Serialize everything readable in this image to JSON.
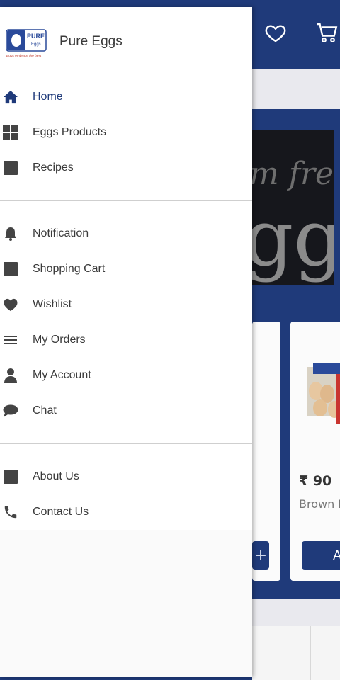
{
  "app": {
    "brand_name": "Pure Eggs",
    "logo_text_top": "PURE",
    "logo_text_sub": "Eggs",
    "logo_tagline": "Eggs embrace the best"
  },
  "drawer": {
    "section1": [
      {
        "label": "Home",
        "icon": "home-icon",
        "active": true
      },
      {
        "label": "Eggs Products",
        "icon": "grid-icon"
      },
      {
        "label": "Recipes",
        "icon": "recipes-icon"
      }
    ],
    "section2": [
      {
        "label": "Notification",
        "icon": "bell-icon"
      },
      {
        "label": "Shopping Cart",
        "icon": "cart-square-icon"
      },
      {
        "label": "Wishlist",
        "icon": "heart-icon"
      },
      {
        "label": "My Orders",
        "icon": "list-icon"
      },
      {
        "label": "My Account",
        "icon": "person-icon"
      },
      {
        "label": "Chat",
        "icon": "chat-bubble-icon"
      }
    ],
    "section3": [
      {
        "label": "About Us",
        "icon": "info-square-icon"
      },
      {
        "label": "Contact Us",
        "icon": "phone-icon"
      }
    ]
  },
  "background": {
    "banner_script": "m fres",
    "banner_big": "ggs",
    "product_price": "₹ 90",
    "product_name": "Brown E",
    "add_label": "A",
    "plus": "+"
  },
  "colors": {
    "primary": "#1f3a7a",
    "icon_gray": "#444444",
    "active_blue": "#1f3a7a"
  }
}
